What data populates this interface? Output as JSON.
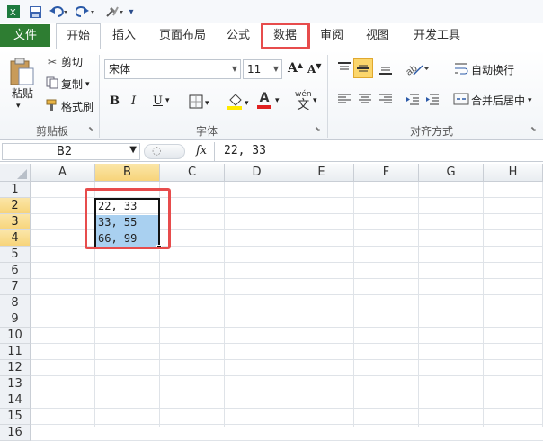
{
  "qat": {
    "save_icon": "save-icon",
    "undo_icon": "undo-icon",
    "redo_icon": "redo-icon",
    "customize_icon": "customize-icon"
  },
  "tabs": [
    {
      "label": "文件"
    },
    {
      "label": "开始"
    },
    {
      "label": "插入"
    },
    {
      "label": "页面布局"
    },
    {
      "label": "公式"
    },
    {
      "label": "数据"
    },
    {
      "label": "审阅"
    },
    {
      "label": "视图"
    },
    {
      "label": "开发工具"
    }
  ],
  "clipboard": {
    "paste": "粘贴",
    "cut": "剪切",
    "copy": "复制",
    "format_painter": "格式刷",
    "group": "剪贴板"
  },
  "font": {
    "name": "宋体",
    "size": "11",
    "bold": "B",
    "italic": "I",
    "underline": "U",
    "font_color": "A",
    "wen": "wén",
    "wen_char": "文",
    "grow": "A",
    "shrink": "A",
    "group": "字体"
  },
  "alignment": {
    "wrap": "自动换行",
    "merge": "合并后居中",
    "group": "对齐方式"
  },
  "formula_bar": {
    "name_box": "B2",
    "fx": "fx",
    "value": "22, 33"
  },
  "columns": [
    "A",
    "B",
    "C",
    "D",
    "E",
    "F",
    "G",
    "H"
  ],
  "rows": [
    "1",
    "2",
    "3",
    "4",
    "5",
    "6",
    "7",
    "8",
    "9",
    "10",
    "11",
    "12",
    "13",
    "14",
    "15",
    "16"
  ],
  "cells": [
    {
      "ref": "B2",
      "value": "22, 33"
    },
    {
      "ref": "B3",
      "value": "33, 55"
    },
    {
      "ref": "B4",
      "value": "66, 99"
    }
  ],
  "colors": {
    "file_tab": "#2e7d32",
    "highlight": "#e74c4c",
    "selection_fill": "#a9d0f0",
    "header_selected": "#f7d47a"
  }
}
